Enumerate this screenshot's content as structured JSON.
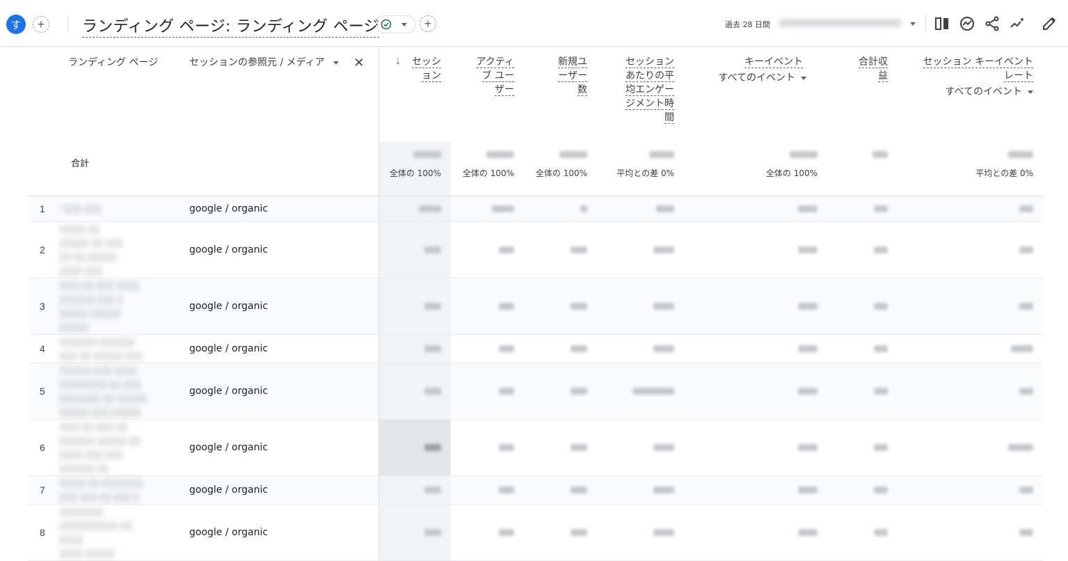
{
  "topbar": {
    "avatar_letter": "す",
    "title": "ランディング ページ: ランディング ページ",
    "date_label": "過去 28 日間",
    "date_range": ""
  },
  "table": {
    "headers": {
      "landing_page": "ランディング ページ",
      "source_medium": "セッションの参照元 / メディア",
      "sessions_l1": "セッシ",
      "sessions_l2": "ョン",
      "active_l1": "アクティ",
      "active_l2": "ブ ユー",
      "active_l3": "ザー",
      "new_l1": "新規ユ",
      "new_l2": "ーザー",
      "new_l3": "数",
      "eng_l1": "セッション",
      "eng_l2": "あたりの平",
      "eng_l3": "均エンゲー",
      "eng_l4": "ジメント時",
      "eng_l5": "間",
      "key_l1": "キーイベント",
      "key_sub": "すべてのイベント",
      "rev_l1": "合計収",
      "rev_l2": "益",
      "rate_l1": "セッション キーイベント",
      "rate_l2": "レート",
      "rate_sub": "すべてのイベント"
    },
    "totals": {
      "label": "合計",
      "sessions_pct": "全体の 100%",
      "active_pct": "全体の 100%",
      "new_pct": "全体の 100%",
      "eng_pct": "平均との差 0%",
      "key_pct": "全体の 100%",
      "rate_pct": "平均との差 0%"
    },
    "rows": [
      {
        "idx": "1",
        "source": "google / organic"
      },
      {
        "idx": "2",
        "source": "google / organic"
      },
      {
        "idx": "3",
        "source": "google / organic"
      },
      {
        "idx": "4",
        "source": "google / organic"
      },
      {
        "idx": "5",
        "source": "google / organic"
      },
      {
        "idx": "6",
        "source": "google / organic"
      },
      {
        "idx": "7",
        "source": "google / organic"
      },
      {
        "idx": "8",
        "source": "google / organic"
      }
    ]
  },
  "colors": {
    "accent": "#1a73e8",
    "success": "#188038",
    "border": "#dadce0"
  },
  "icons": [
    "plus-icon",
    "check-circle-icon",
    "compare-icon",
    "insights-icon",
    "share-icon",
    "sparkline-icon",
    "edit-icon",
    "close-icon",
    "arrow-down-icon"
  ]
}
